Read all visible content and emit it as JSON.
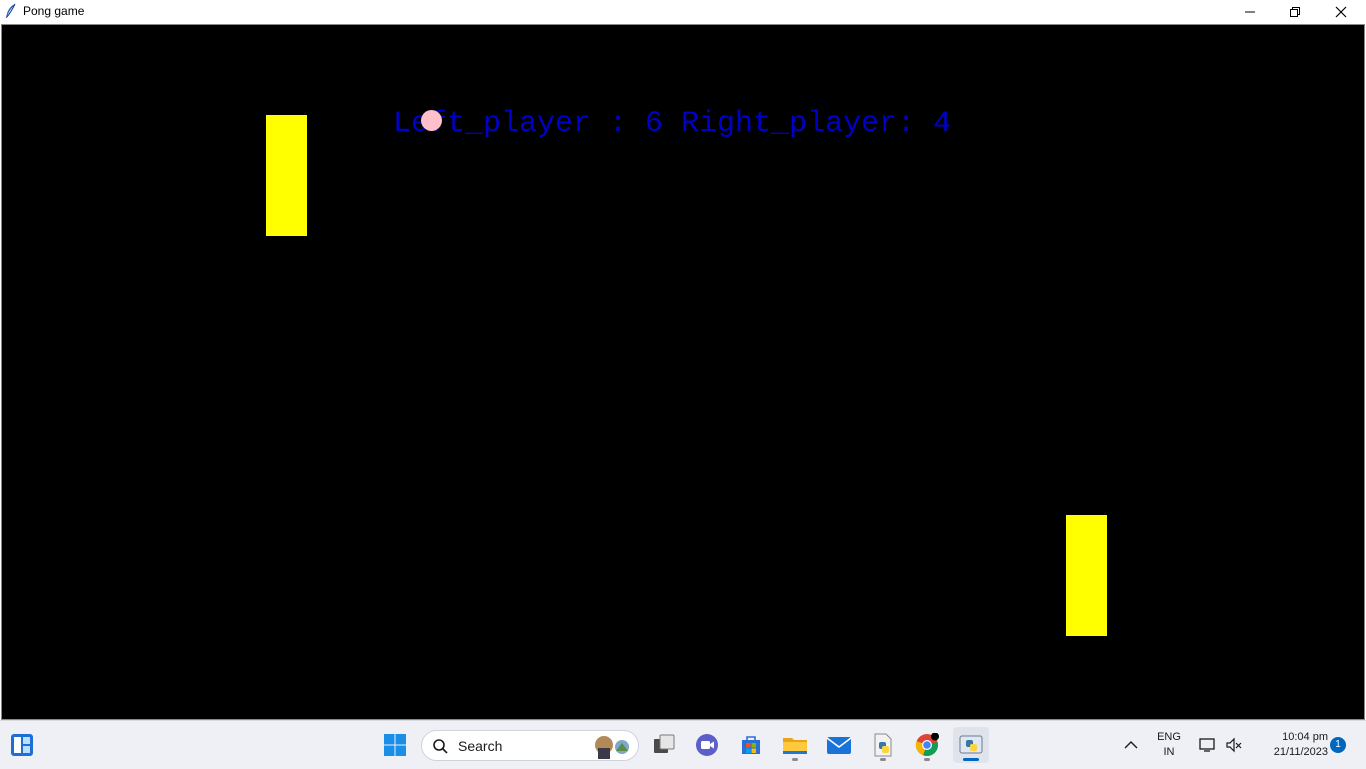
{
  "window": {
    "title": "Pong game",
    "controls": {
      "minimize": "minimize-icon",
      "maximize": "restore-icon",
      "close": "close-icon"
    }
  },
  "game": {
    "score_text": "Left_player : 6 Right_player: 4",
    "left_score": 6,
    "right_score": 4,
    "colors": {
      "background": "#000000",
      "paddle": "#ffff00",
      "ball": "#ffc0cb",
      "score": "#0000c8"
    }
  },
  "taskbar": {
    "search_placeholder": "Search",
    "apps": [
      "widgets-icon",
      "start-icon",
      "task-view-icon",
      "meet-icon",
      "store-icon",
      "file-explorer-icon",
      "mail-icon",
      "python-file-icon",
      "chrome-icon",
      "python-app-icon"
    ],
    "tray": {
      "language_line1": "ENG",
      "language_line2": "IN",
      "time": "10:04 pm",
      "date": "21/11/2023",
      "notification_count": "1"
    }
  }
}
